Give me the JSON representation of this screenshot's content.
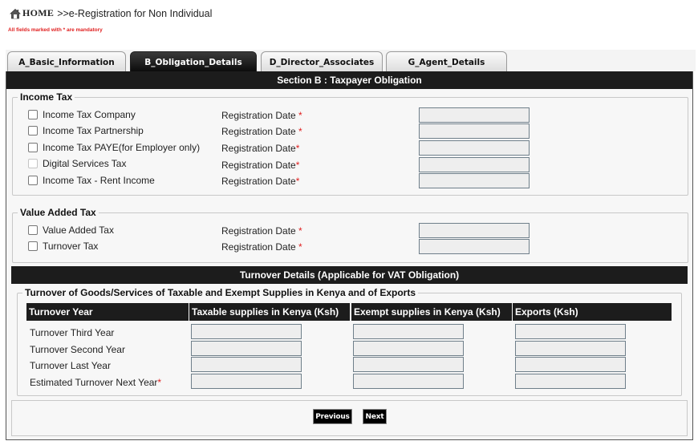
{
  "breadcrumb": {
    "home_icon": "home-icon",
    "home_label": "HOME",
    "path": ">>e-Registration for Non Individual"
  },
  "notice": "All fields marked with * are mandatory",
  "tabs": [
    {
      "label": "A_Basic_Information",
      "active": false
    },
    {
      "label": "B_Obligation_Details",
      "active": true
    },
    {
      "label": "D_Director_Associates",
      "active": false
    },
    {
      "label": "G_Agent_Details",
      "active": false
    }
  ],
  "section_title": "Section B : Taxpayer Obligation",
  "income_tax": {
    "legend": "Income Tax",
    "items": [
      {
        "label": "Income Tax Company",
        "date_label": "Registration Date ",
        "required": "*",
        "checked": false,
        "disabled": false,
        "date_value": ""
      },
      {
        "label": "Income Tax Partnership",
        "date_label": "Registration Date ",
        "required": "*",
        "checked": false,
        "disabled": false,
        "date_value": ""
      },
      {
        "label": "Income Tax PAYE(for Employer only)",
        "date_label": "Registration Date",
        "required": "*",
        "checked": false,
        "disabled": false,
        "date_value": ""
      },
      {
        "label": "Digital Services Tax",
        "date_label": "Registration Date",
        "required": "*",
        "checked": false,
        "disabled": true,
        "date_value": ""
      },
      {
        "label": "Income Tax - Rent Income",
        "date_label": "Registration Date",
        "required": "*",
        "checked": false,
        "disabled": false,
        "date_value": ""
      }
    ]
  },
  "vat": {
    "legend": "Value Added Tax",
    "items": [
      {
        "label": "Value Added Tax",
        "date_label": "Registration Date ",
        "required": "*",
        "checked": false,
        "date_value": ""
      },
      {
        "label": "Turnover Tax",
        "date_label": "Registration Date ",
        "required": "*",
        "checked": false,
        "date_value": ""
      }
    ]
  },
  "turnover": {
    "header": "Turnover Details (Applicable for VAT Obligation)",
    "legend": "Turnover of Goods/Services of Taxable and Exempt Supplies in Kenya and of Exports",
    "columns": [
      "Turnover Year",
      "Taxable supplies in Kenya (Ksh)",
      "Exempt supplies in Kenya (Ksh)",
      "Exports (Ksh)"
    ],
    "rows": [
      {
        "label": "Turnover Third Year",
        "required": "",
        "values": [
          "",
          "",
          ""
        ]
      },
      {
        "label": "Turnover Second Year",
        "required": "",
        "values": [
          "",
          "",
          ""
        ]
      },
      {
        "label": "Turnover Last Year",
        "required": "",
        "values": [
          "",
          "",
          ""
        ]
      },
      {
        "label": "Estimated Turnover Next Year",
        "required": "*",
        "values": [
          "",
          "",
          ""
        ]
      }
    ]
  },
  "buttons": {
    "previous": "Previous",
    "next": "Next"
  }
}
